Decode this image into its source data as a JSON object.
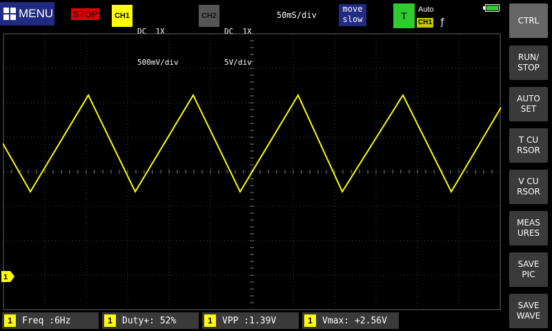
{
  "topbar": {
    "menu_label": "MENU",
    "run_state": "STOP",
    "ch1": {
      "badge": "CH1",
      "line1": "DC  1X",
      "line2": "500mV/div"
    },
    "ch2": {
      "badge": "CH2",
      "line1": "DC  1X",
      "line2": "5V/div"
    },
    "timebase": "50mS/div",
    "move_line1": "move",
    "move_line2": "slow",
    "trigger_badge": "T",
    "trigger_mode": "Auto",
    "trigger_channel": "CH1",
    "trigger_slope": "ƒ"
  },
  "side_buttons": [
    "CTRL",
    "RUN/\nSTOP",
    "AUTO\nSET",
    "T CU\nRSOR",
    "V CU\nRSOR",
    "MEAS\nURES",
    "SAVE\nPIC",
    "SAVE\nWAVE"
  ],
  "channel_marker": "1",
  "measurements": [
    {
      "ch": "1",
      "label": "Freq :6Hz"
    },
    {
      "ch": "1",
      "label": "Duty+: 52%"
    },
    {
      "ch": "1",
      "label": "VPP  :1.39V"
    },
    {
      "ch": "1",
      "label": "Vmax: +2.56V"
    }
  ],
  "colors": {
    "ch1": "#ffff00",
    "grid": "#555555",
    "accent": "#1f2a80",
    "trigger": "#2ecc2e",
    "stop": "#e00000"
  }
}
